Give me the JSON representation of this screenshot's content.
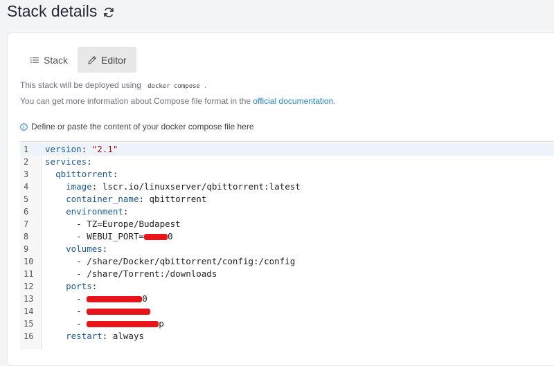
{
  "header": {
    "title": "Stack details",
    "refresh_icon": "refresh-icon"
  },
  "tabs": [
    {
      "label": "Stack",
      "icon": "list-icon",
      "active": false
    },
    {
      "label": "Editor",
      "icon": "pencil-icon",
      "active": true
    }
  ],
  "info": {
    "deploy_prefix": "This stack will be deployed using",
    "deploy_code": "docker compose",
    "deploy_suffix": ".",
    "doc_prefix": "You can get more information about Compose file format in the",
    "doc_link": "official documentation",
    "doc_suffix": ".",
    "hint": "Define or paste the content of your docker compose file here",
    "hint_icon": "info-circle-icon"
  },
  "colors": {
    "accent": "#1d7fc4",
    "yaml_key": "#1c5a96",
    "yaml_string": "#aa1111",
    "redaction": "#e8141a"
  },
  "editor": {
    "active_line": 1,
    "lines": [
      {
        "n": "1",
        "indent": "",
        "key": "version",
        "sep": ": ",
        "str": "\"2.1\"",
        "text": ""
      },
      {
        "n": "2",
        "indent": "",
        "key": "services",
        "sep": ":",
        "str": "",
        "text": ""
      },
      {
        "n": "3",
        "indent": "  ",
        "key": "qbittorrent",
        "sep": ":",
        "str": "",
        "text": ""
      },
      {
        "n": "4",
        "indent": "    ",
        "key": "image",
        "sep": ": ",
        "str": "",
        "text": "lscr.io/linuxserver/qbittorrent:latest"
      },
      {
        "n": "5",
        "indent": "    ",
        "key": "container_name",
        "sep": ": ",
        "str": "",
        "text": "qbittorrent"
      },
      {
        "n": "6",
        "indent": "    ",
        "key": "environment",
        "sep": ":",
        "str": "",
        "text": ""
      },
      {
        "n": "7",
        "indent": "      ",
        "key": "",
        "sep": "",
        "str": "",
        "text": "- TZ=Europe/Budapest"
      },
      {
        "n": "8",
        "indent": "      ",
        "key": "",
        "sep": "",
        "str": "",
        "text": "- WEBUI_PORT=",
        "redacted": true,
        "tail": "0"
      },
      {
        "n": "9",
        "indent": "    ",
        "key": "volumes",
        "sep": ":",
        "str": "",
        "text": ""
      },
      {
        "n": "10",
        "indent": "      ",
        "key": "",
        "sep": "",
        "str": "",
        "text": "- /share/Docker/qbittorrent/config:/config"
      },
      {
        "n": "11",
        "indent": "      ",
        "key": "",
        "sep": "",
        "str": "",
        "text": "- /share/Torrent:/downloads"
      },
      {
        "n": "12",
        "indent": "    ",
        "key": "ports",
        "sep": ":",
        "str": "",
        "text": ""
      },
      {
        "n": "13",
        "indent": "      ",
        "key": "",
        "sep": "",
        "str": "",
        "text": "- ",
        "redacted": true,
        "tail": "0"
      },
      {
        "n": "14",
        "indent": "      ",
        "key": "",
        "sep": "",
        "str": "",
        "text": "- ",
        "redacted": true,
        "tail": ""
      },
      {
        "n": "15",
        "indent": "      ",
        "key": "",
        "sep": "",
        "str": "",
        "text": "- ",
        "redacted": true,
        "tail": "p"
      },
      {
        "n": "16",
        "indent": "    ",
        "key": "restart",
        "sep": ": ",
        "str": "",
        "text": "always"
      }
    ]
  }
}
